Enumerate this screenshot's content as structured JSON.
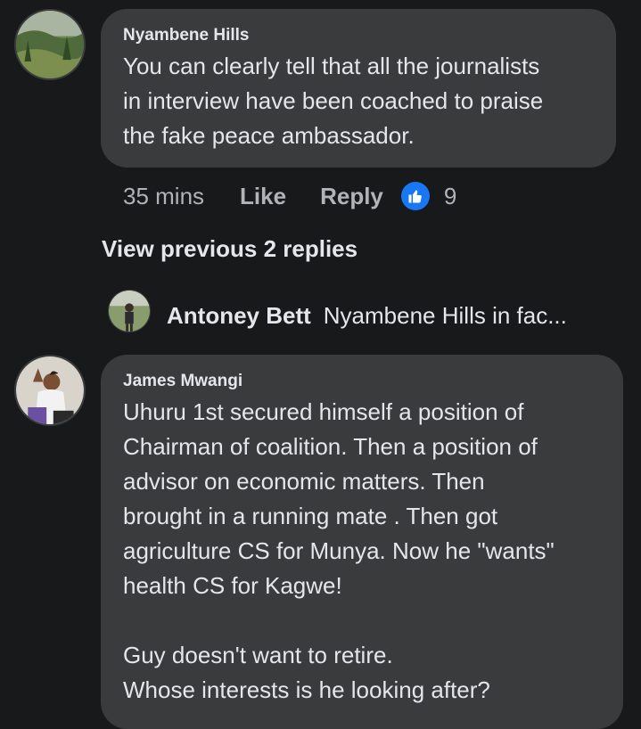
{
  "comments": [
    {
      "author": "Nyambene Hills",
      "text": "You can clearly tell that all the journalists\nin  interview have been coached to praise\nthe fake peace ambassador.",
      "time": "35 mins",
      "like_label": "Like",
      "reply_label": "Reply",
      "reaction_icon": "thumbs-up-icon",
      "reaction_count": "9"
    },
    {
      "author": "James Mwangi",
      "text": "Uhuru 1st secured himself a position of\nChairman of coalition. Then a position of\nadvisor on economic matters. Then\nbrought in a running mate . Then got\nagriculture CS for Munya. Now he \"wants\"\nhealth CS for Kagwe!\n\nGuy doesn't want to retire.\nWhose interests is he looking after?"
    }
  ],
  "view_previous_label": "View previous 2 replies",
  "reply_preview": {
    "author": "Antoney Bett",
    "snippet": "Nyambene Hills in fac..."
  },
  "colors": {
    "background": "#18191a",
    "bubble": "#3a3b3c",
    "text_primary": "#e4e6eb",
    "text_secondary": "#b0b3b8",
    "reaction_blue": "#1877f2"
  }
}
